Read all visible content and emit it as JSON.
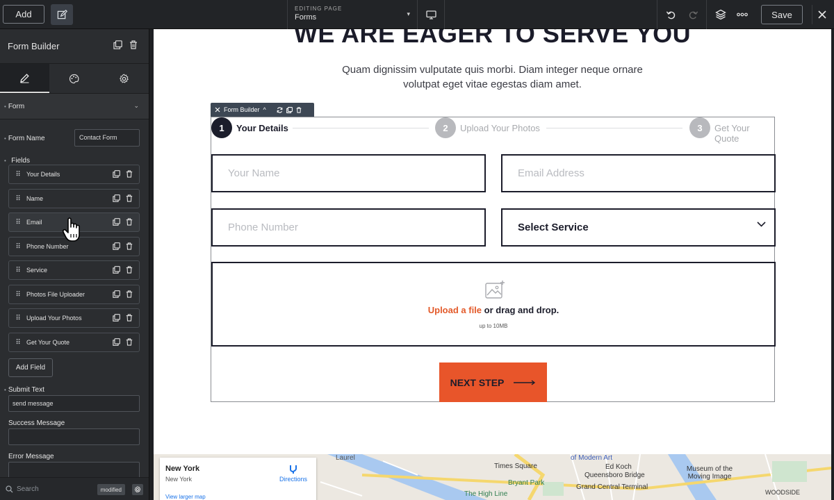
{
  "topbar": {
    "add_label": "Add",
    "editing_caption": "EDITING PAGE",
    "editing_page": "Forms",
    "save_label": "Save"
  },
  "sidebar": {
    "title": "Form Builder",
    "section_title": "Form",
    "form_name_label": "Form Name",
    "form_name_value": "Contact Form",
    "fields_label": "Fields",
    "fields": [
      {
        "label": "Your Details"
      },
      {
        "label": "Name"
      },
      {
        "label": "Email"
      },
      {
        "label": "Phone Number"
      },
      {
        "label": "Service"
      },
      {
        "label": "Photos File Uploader"
      },
      {
        "label": "Upload Your Photos"
      },
      {
        "label": "Get Your Quote"
      }
    ],
    "add_field_label": "Add Field",
    "submit_text_label": "Submit Text",
    "submit_text_value": "send message",
    "success_message_label": "Success Message",
    "success_message_value": "",
    "error_message_label": "Error Message",
    "search_placeholder": "Search",
    "modified_badge": "modified"
  },
  "canvas": {
    "heading": "WE ARE EAGER TO SERVE YOU",
    "subtitle": "Quam dignissim vulputate quis morbi. Diam integer neque ornare volutpat eget vitae egestas diam amet.",
    "builder_tag": "Form Builder",
    "steps": [
      {
        "num": "1",
        "label": "Your Details"
      },
      {
        "num": "2",
        "label": "Upload Your Photos"
      },
      {
        "num": "3",
        "label": "Get Your Quote"
      }
    ],
    "name_placeholder": "Your Name",
    "email_placeholder": "Email Address",
    "phone_placeholder": "Phone Number",
    "service_select": "Select Service",
    "upload_link": "Upload a file",
    "upload_rest": " or drag and drop.",
    "upload_limit": "up to 10MB",
    "next_button": "NEXT STEP"
  },
  "map": {
    "place_title": "New York",
    "place_sub": "New York",
    "directions": "Directions",
    "larger_map": "View larger map",
    "labels": {
      "laurel": "Laurel",
      "times_square": "Times Square",
      "modern_art": "of Modern Art",
      "ed_koch": "Ed Koch",
      "queensboro": "Queensboro Bridge",
      "bryant_park": "Bryant Park",
      "grand_central": "Grand Central Terminal",
      "high_line": "The High Line",
      "moving_image": "Museum of the Moving Image",
      "woodside": "WOODSIDE"
    }
  },
  "colors": {
    "accent": "#e8552a",
    "dark": "#1b1c2a",
    "sidebar_bg": "#2b2d30"
  }
}
